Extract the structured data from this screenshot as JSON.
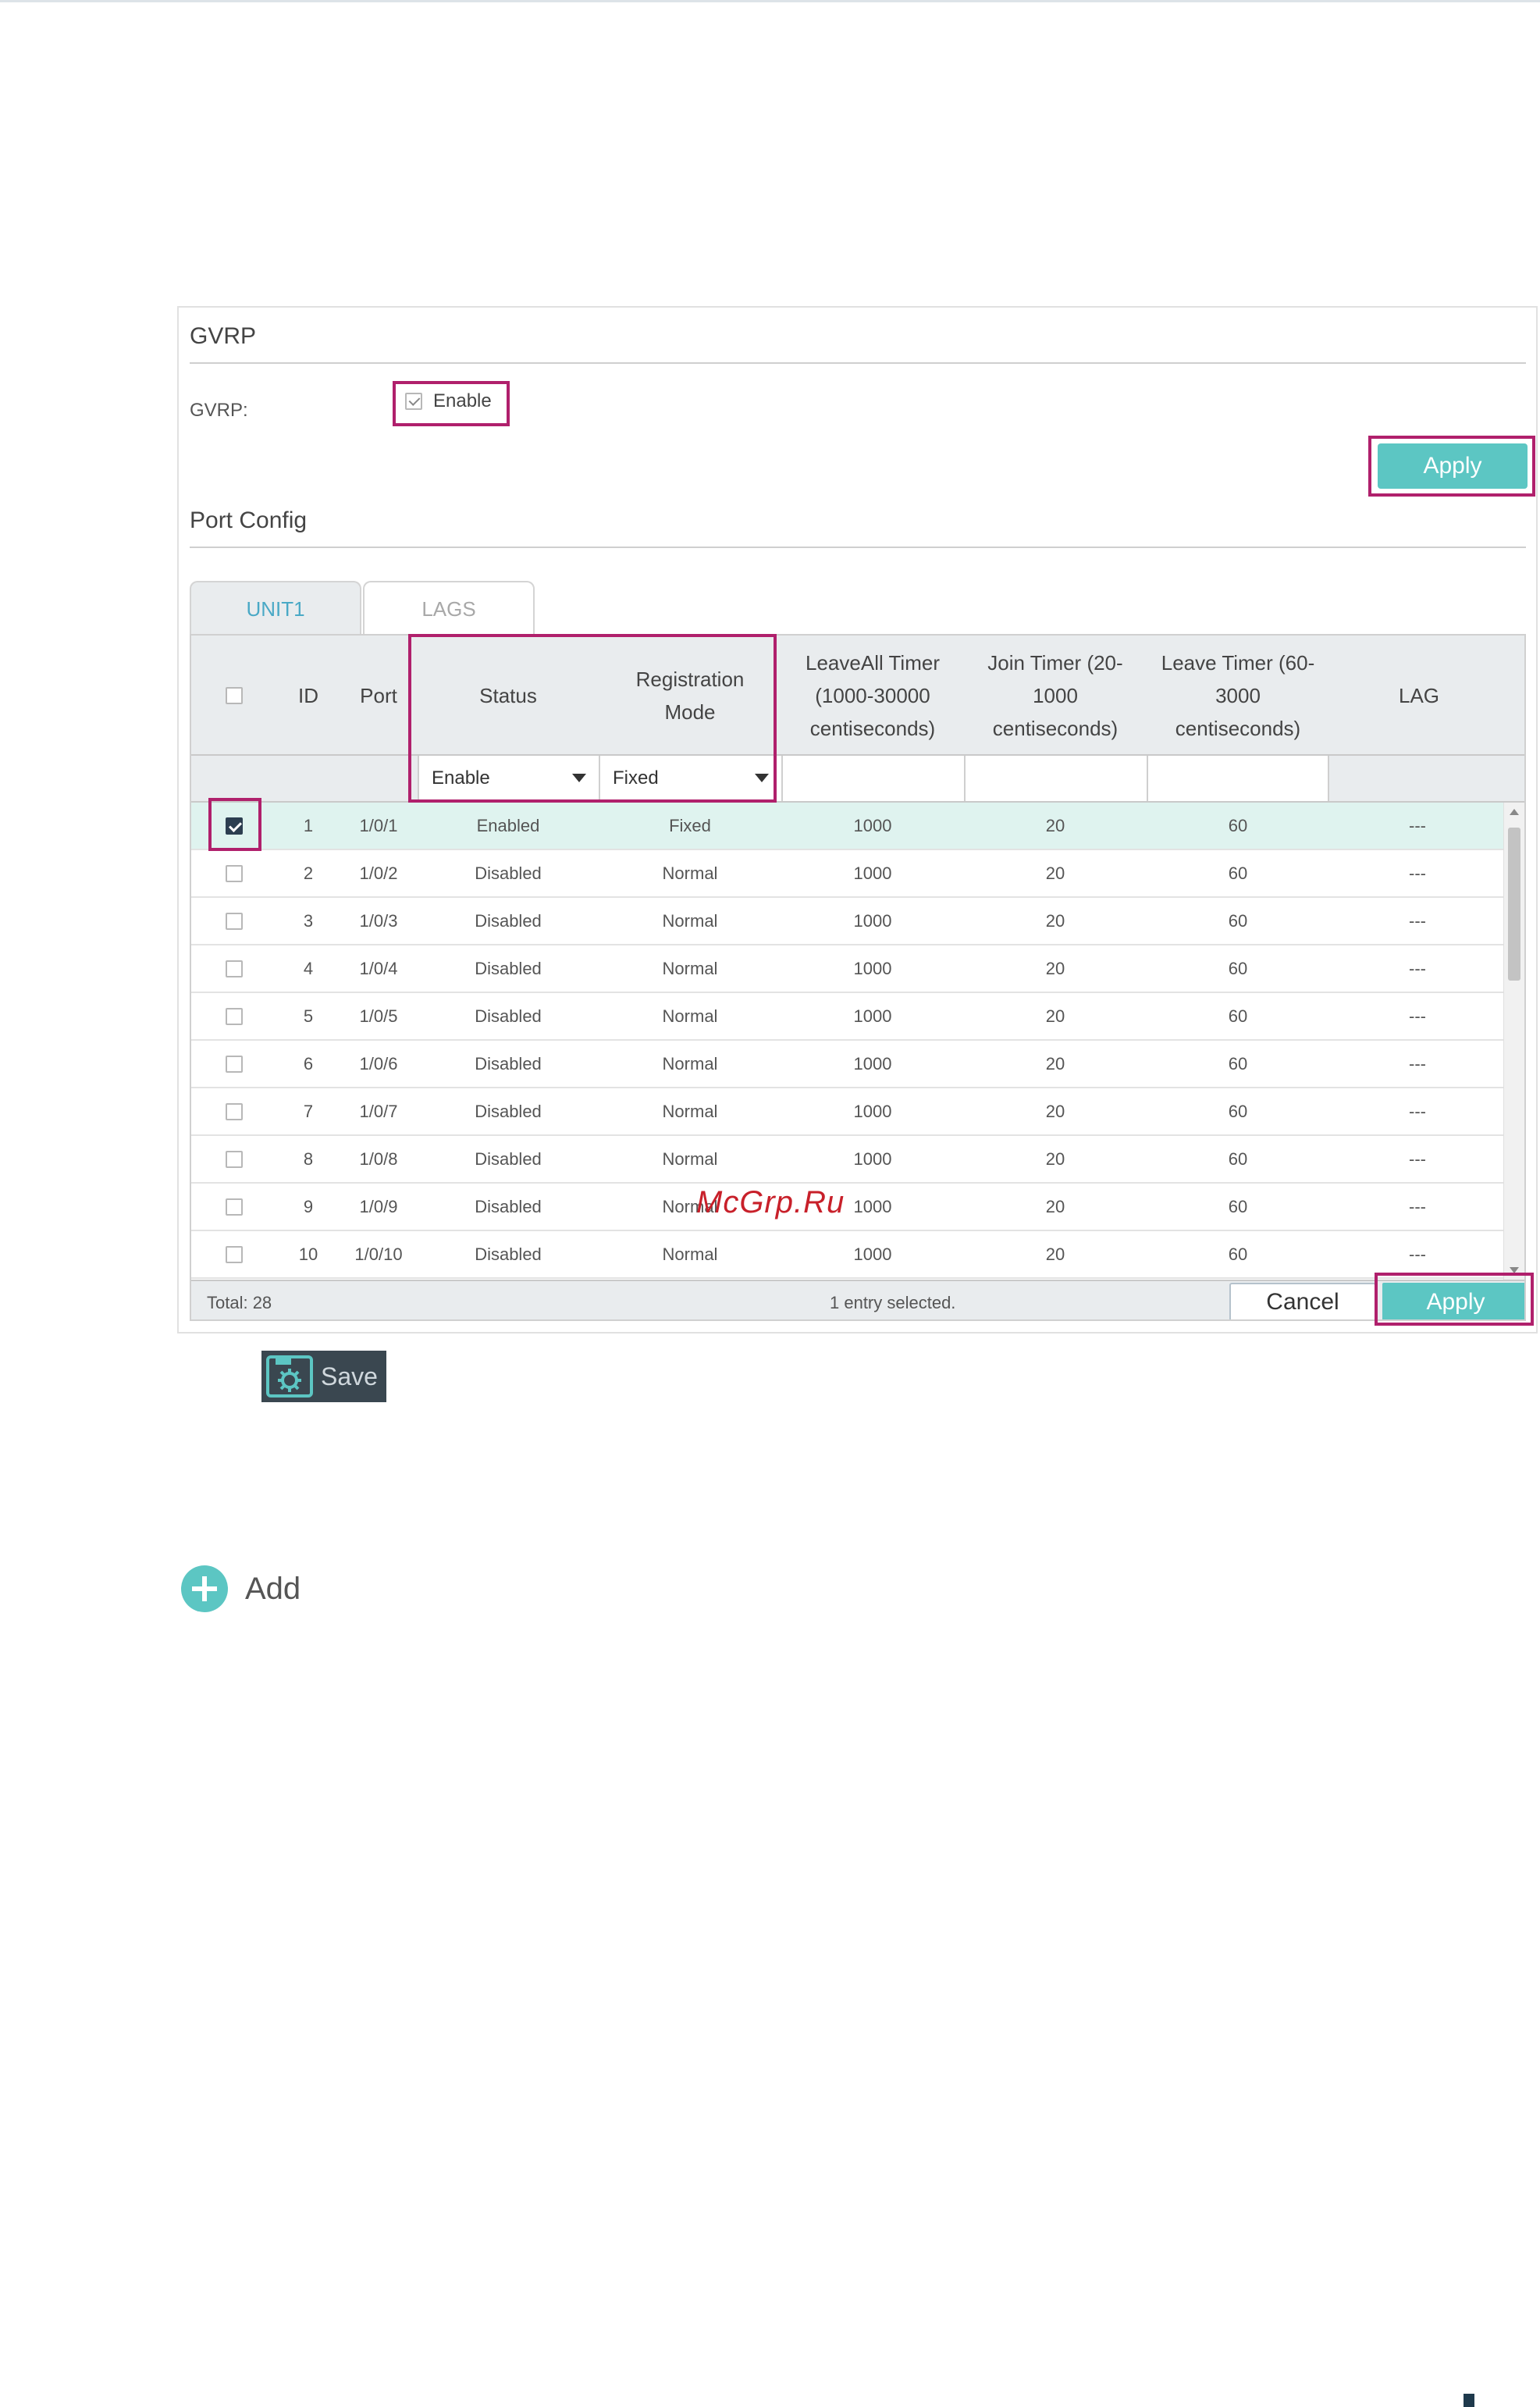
{
  "gvrp_section": {
    "title": "GVRP",
    "label": "GVRP:",
    "enable_label": "Enable",
    "enabled": true,
    "apply_label": "Apply"
  },
  "port_config": {
    "title": "Port Config",
    "tabs": [
      {
        "label": "UNIT1",
        "active": true
      },
      {
        "label": "LAGS",
        "active": false
      }
    ],
    "columns": {
      "id": "ID",
      "port": "Port",
      "status": "Status",
      "registration_mode": "Registration Mode",
      "leaveall_timer": "LeaveAll Timer (1000-30000 centiseconds)",
      "join_timer": "Join Timer (20-1000 centiseconds)",
      "leave_timer": "Leave Timer (60-3000 centiseconds)",
      "lag": "LAG"
    },
    "filters": {
      "status": "Enable",
      "registration_mode": "Fixed",
      "leaveall_timer": "",
      "join_timer": "",
      "leave_timer": ""
    },
    "rows": [
      {
        "id": "1",
        "port": "1/0/1",
        "status": "Enabled",
        "mode": "Fixed",
        "leaveall": "1000",
        "join": "20",
        "leave": "60",
        "lag": "---",
        "selected": true
      },
      {
        "id": "2",
        "port": "1/0/2",
        "status": "Disabled",
        "mode": "Normal",
        "leaveall": "1000",
        "join": "20",
        "leave": "60",
        "lag": "---",
        "selected": false
      },
      {
        "id": "3",
        "port": "1/0/3",
        "status": "Disabled",
        "mode": "Normal",
        "leaveall": "1000",
        "join": "20",
        "leave": "60",
        "lag": "---",
        "selected": false
      },
      {
        "id": "4",
        "port": "1/0/4",
        "status": "Disabled",
        "mode": "Normal",
        "leaveall": "1000",
        "join": "20",
        "leave": "60",
        "lag": "---",
        "selected": false
      },
      {
        "id": "5",
        "port": "1/0/5",
        "status": "Disabled",
        "mode": "Normal",
        "leaveall": "1000",
        "join": "20",
        "leave": "60",
        "lag": "---",
        "selected": false
      },
      {
        "id": "6",
        "port": "1/0/6",
        "status": "Disabled",
        "mode": "Normal",
        "leaveall": "1000",
        "join": "20",
        "leave": "60",
        "lag": "---",
        "selected": false
      },
      {
        "id": "7",
        "port": "1/0/7",
        "status": "Disabled",
        "mode": "Normal",
        "leaveall": "1000",
        "join": "20",
        "leave": "60",
        "lag": "---",
        "selected": false
      },
      {
        "id": "8",
        "port": "1/0/8",
        "status": "Disabled",
        "mode": "Normal",
        "leaveall": "1000",
        "join": "20",
        "leave": "60",
        "lag": "---",
        "selected": false
      },
      {
        "id": "9",
        "port": "1/0/9",
        "status": "Disabled",
        "mode": "Normal",
        "leaveall": "1000",
        "join": "20",
        "leave": "60",
        "lag": "---",
        "selected": false
      },
      {
        "id": "10",
        "port": "1/0/10",
        "status": "Disabled",
        "mode": "Normal",
        "leaveall": "1000",
        "join": "20",
        "leave": "60",
        "lag": "---",
        "selected": false
      }
    ],
    "footer": {
      "total": "Total: 28",
      "selection": "1 entry selected.",
      "cancel_label": "Cancel",
      "apply_label": "Apply"
    }
  },
  "watermark": "McGrp.Ru",
  "save_label": "Save",
  "add_label": "Add",
  "colors": {
    "accent": "#5cc6c3",
    "highlight_box": "#b0206c",
    "header_bg": "#e9ecee",
    "selected_row": "#dff3ef"
  }
}
